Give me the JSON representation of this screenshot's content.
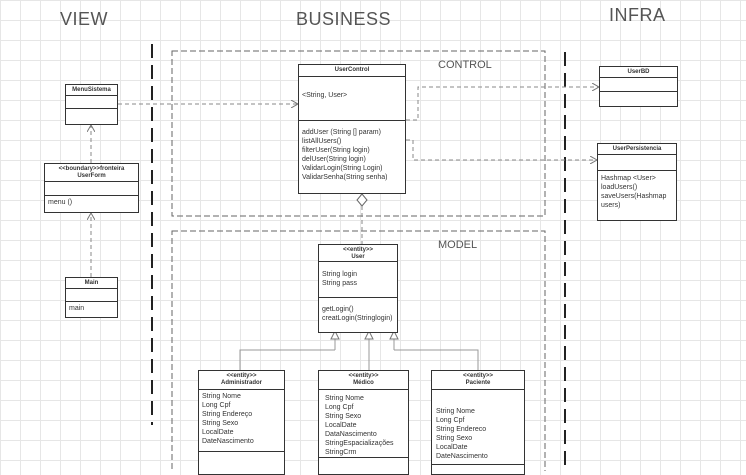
{
  "headings": {
    "view": "VIEW",
    "business": "BUSINESS",
    "infra": "INFRA"
  },
  "packages": {
    "control": "CONTROL",
    "model": "MODEL"
  },
  "classes": {
    "menu_sistema": {
      "name": "MenuSistema"
    },
    "user_form": {
      "stereotype": "<<boundary>>fronteira",
      "name": "UserForm",
      "methods": [
        "menu ()"
      ]
    },
    "main": {
      "name": "Main",
      "methods": [
        "main"
      ]
    },
    "user_control": {
      "name": "UserControl",
      "attributes": [
        "<String, User>"
      ],
      "methods": [
        "addUser (String [] param)",
        "listAllUsers()",
        "filterUser(String login)",
        "delUser(String login)",
        "ValidarLogin(String Login)",
        "ValidarSenha(String senha)"
      ]
    },
    "user_bd": {
      "name": "UserBD"
    },
    "user_persistencia": {
      "name": "UserPersistencia",
      "methods": [
        "Hashmap <User>",
        "loadUsers()",
        "saveUsers(Hashmap",
        "users)"
      ]
    },
    "user": {
      "stereotype": "<<entity>>",
      "name": "User",
      "attributes": [
        "String login",
        "String pass"
      ],
      "methods": [
        "getLogin()",
        "creatLogin(Stringlogin)"
      ]
    },
    "administrador": {
      "stereotype": "<<entity>>",
      "name": "Administrador",
      "attributes": [
        "String Nome",
        "Long Cpf",
        "String Endereço",
        "String Sexo",
        "LocalDate",
        "DateNascimento"
      ]
    },
    "medico": {
      "stereotype": "<<entity>>",
      "name": "Médico",
      "attributes": [
        "String Nome",
        "Long Cpf",
        "String Sexo",
        "LocalDate",
        "DataNascimento",
        "StringEspacializações",
        "StringCrm"
      ]
    },
    "paciente": {
      "stereotype": "<<entity>>",
      "name": "Paciente",
      "attributes": [
        "String Nome",
        "Long Cpf",
        "String Endereco",
        "String Sexo",
        "LocalDate",
        "DateNascimento"
      ]
    }
  }
}
